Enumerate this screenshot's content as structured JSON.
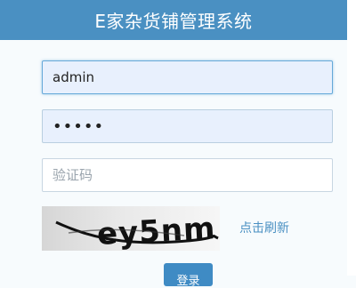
{
  "header": {
    "title": "E家杂货铺管理系统"
  },
  "form": {
    "username": {
      "value": "admin"
    },
    "password": {
      "value": "•••••"
    },
    "captcha": {
      "placeholder": "验证码",
      "value": ""
    },
    "captcha_image": {
      "text": "ey5nm"
    },
    "refresh_label": "点击刷新",
    "login_label": "登录"
  },
  "colors": {
    "header_bg": "#4a90c2",
    "link": "#4a90c2",
    "button_bg": "#3f8bc4",
    "filled_input_bg": "#e8f0fd"
  }
}
